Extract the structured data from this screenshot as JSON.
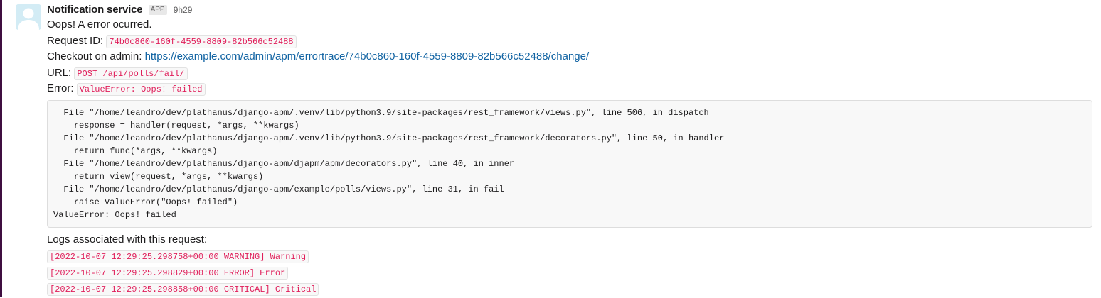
{
  "message": {
    "sender": "Notification service",
    "badge": "APP",
    "time": "9h29",
    "intro": "Oops! A error ocurred.",
    "request_id_label": "Request ID:",
    "request_id": "74b0c860-160f-4559-8809-82b566c52488",
    "checkout_label": "Checkout on admin:",
    "checkout_link": "https://example.com/admin/apm/errortrace/74b0c860-160f-4559-8809-82b566c52488/change/",
    "url_label": "URL:",
    "url_value": "POST /api/polls/fail/",
    "error_label": "Error:",
    "error_value": "ValueError: Oops! failed",
    "traceback": [
      "  File \"/home/leandro/dev/plathanus/django-apm/.venv/lib/python3.9/site-packages/rest_framework/views.py\", line 506, in dispatch",
      "    response = handler(request, *args, **kwargs)",
      "  File \"/home/leandro/dev/plathanus/django-apm/.venv/lib/python3.9/site-packages/rest_framework/decorators.py\", line 50, in handler",
      "    return func(*args, **kwargs)",
      "  File \"/home/leandro/dev/plathanus/django-apm/djapm/apm/decorators.py\", line 40, in inner",
      "    return view(request, *args, **kwargs)",
      "  File \"/home/leandro/dev/plathanus/django-apm/example/polls/views.py\", line 31, in fail",
      "    raise ValueError(\"Oops! failed\")",
      "ValueError: Oops! failed"
    ],
    "logs_label": "Logs associated with this request:",
    "logs": [
      "[2022-10-07 12:29:25.298758+00:00 WARNING] Warning",
      "[2022-10-07 12:29:25.298829+00:00 ERROR] Error",
      "[2022-10-07 12:29:25.298858+00:00 CRITICAL] Critical"
    ]
  },
  "icons": {
    "avatar": "default-user-avatar-icon"
  },
  "colors": {
    "code_text": "#e01e5a",
    "link": "#1264a3",
    "avatar_bg": "#d3ecf5"
  }
}
